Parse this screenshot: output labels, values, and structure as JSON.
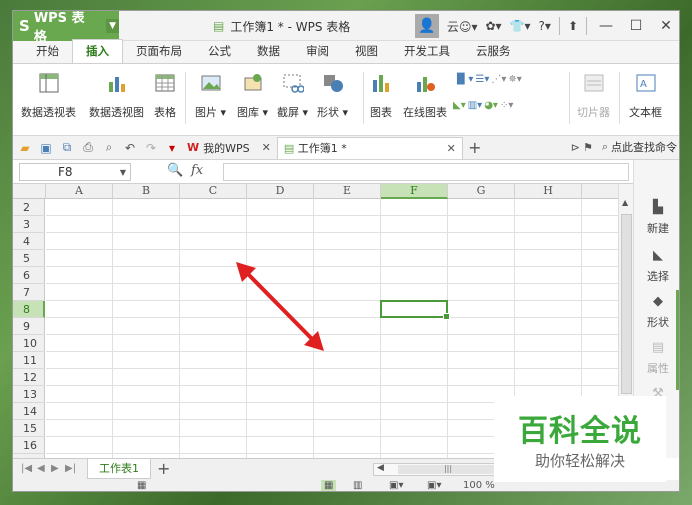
{
  "app": {
    "name": "WPS 表格",
    "logo_glyph": "S",
    "window_title": "工作簿1 * - WPS 表格",
    "user_label": "云",
    "help_label": "?"
  },
  "menu_tabs": [
    {
      "label": "开始",
      "active": false
    },
    {
      "label": "插入",
      "active": true
    },
    {
      "label": "页面布局",
      "active": false
    },
    {
      "label": "公式",
      "active": false
    },
    {
      "label": "数据",
      "active": false
    },
    {
      "label": "审阅",
      "active": false
    },
    {
      "label": "视图",
      "active": false
    },
    {
      "label": "开发工具",
      "active": false
    },
    {
      "label": "云服务",
      "active": false
    }
  ],
  "ribbon": {
    "pivot_table": "数据透视表",
    "pivot_chart": "数据透视图",
    "table": "表格",
    "picture": "图片",
    "gallery": "图库",
    "screenshot": "截屏",
    "shapes": "形状",
    "chart": "图表",
    "online_chart": "在线图表",
    "slicer": "切片器",
    "textbox": "文本框"
  },
  "quickbar": {
    "my_wps": "我的WPS",
    "doc_tab": "工作簿1 *",
    "search_cmd": "点此查找命令"
  },
  "formula": {
    "cell_ref": "F8",
    "fx": "fx",
    "value": ""
  },
  "columns": [
    "A",
    "B",
    "C",
    "D",
    "E",
    "F",
    "G",
    "H"
  ],
  "selected_column": "F",
  "rows": [
    "2",
    "3",
    "4",
    "5",
    "6",
    "7",
    "8",
    "9",
    "10",
    "11",
    "12",
    "13",
    "14",
    "15",
    "16"
  ],
  "selected_row": "8",
  "taskpane": {
    "new": "新建",
    "select": "选择",
    "shape": "形状",
    "property": "属性"
  },
  "sheet": {
    "tab": "工作表1",
    "add": "+"
  },
  "status": {
    "zoom": "100 %"
  },
  "watermark": {
    "title": "百科全说",
    "subtitle": "助你轻松解决"
  },
  "colors": {
    "accent": "#6aa84f",
    "arrow": "#e02020",
    "watermark": "#3aa83a"
  }
}
